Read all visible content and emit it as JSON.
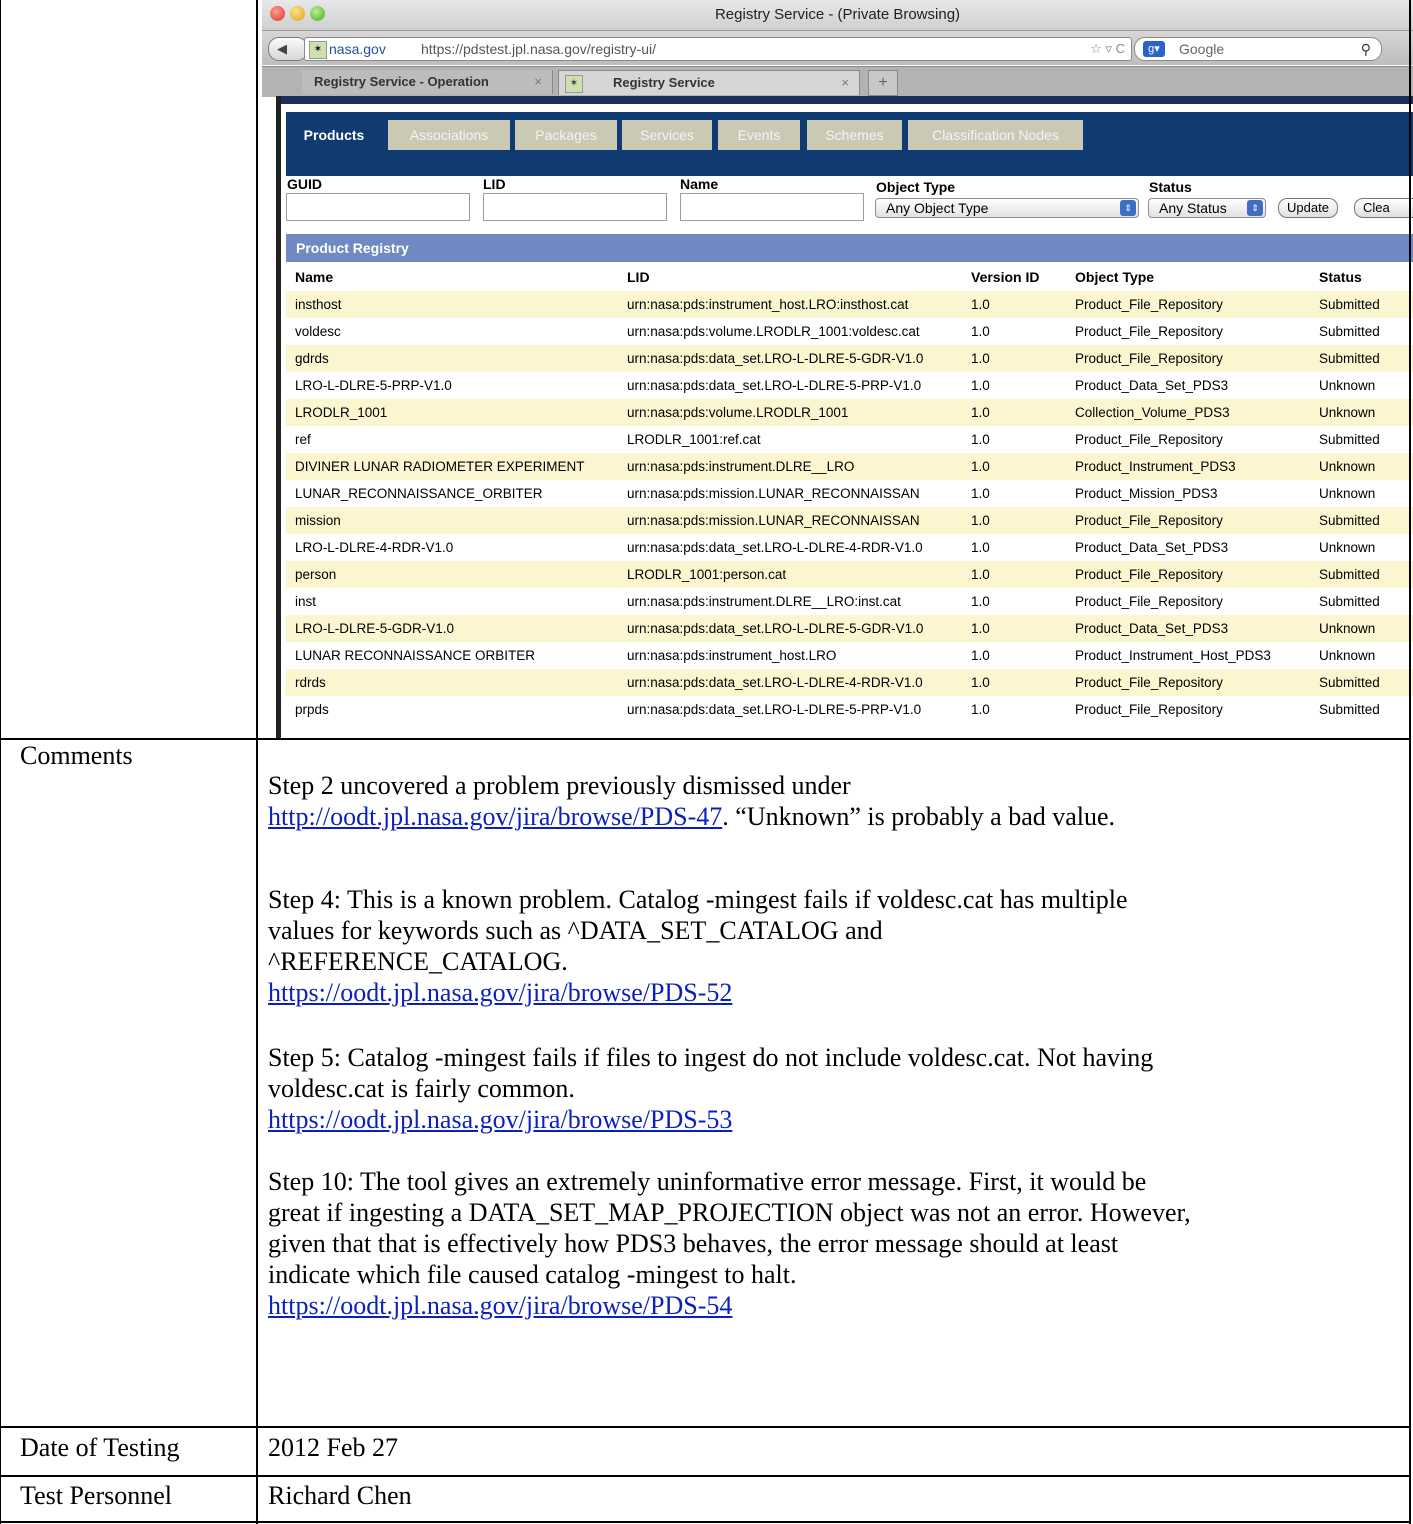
{
  "browser": {
    "window_title": "Registry Service - (Private Browsing)",
    "url_domain": "nasa.gov",
    "url": "https://pdstest.jpl.nasa.gov/registry-ui/",
    "search_engine": "Google",
    "tabs": [
      {
        "label": "Registry Service - Operation"
      },
      {
        "label": "Registry Service"
      }
    ],
    "new_tab": "+"
  },
  "app": {
    "nav_tabs": [
      {
        "label": "Products",
        "active": true
      },
      {
        "label": "Associations"
      },
      {
        "label": "Packages"
      },
      {
        "label": "Services"
      },
      {
        "label": "Events"
      },
      {
        "label": "Schemes"
      },
      {
        "label": "Classification Nodes"
      }
    ],
    "filters": {
      "guid_label": "GUID",
      "lid_label": "LID",
      "name_label": "Name",
      "object_type_label": "Object Type",
      "object_type_value": "Any Object Type",
      "status_label": "Status",
      "status_value": "Any Status",
      "update_button": "Update",
      "clear_button": "Clea"
    },
    "registry_title": "Product Registry",
    "columns": [
      "Name",
      "LID",
      "Version ID",
      "Object Type",
      "Status"
    ],
    "rows": [
      [
        "insthost",
        "urn:nasa:pds:instrument_host.LRO:insthost.cat",
        "1.0",
        "Product_File_Repository",
        "Submitted"
      ],
      [
        "voldesc",
        "urn:nasa:pds:volume.LRODLR_1001:voldesc.cat",
        "1.0",
        "Product_File_Repository",
        "Submitted"
      ],
      [
        "gdrds",
        "urn:nasa:pds:data_set.LRO-L-DLRE-5-GDR-V1.0",
        "1.0",
        "Product_File_Repository",
        "Submitted"
      ],
      [
        "LRO-L-DLRE-5-PRP-V1.0",
        "urn:nasa:pds:data_set.LRO-L-DLRE-5-PRP-V1.0",
        "1.0",
        "Product_Data_Set_PDS3",
        "Unknown"
      ],
      [
        "LRODLR_1001",
        "urn:nasa:pds:volume.LRODLR_1001",
        "1.0",
        "Collection_Volume_PDS3",
        "Unknown"
      ],
      [
        "ref",
        "LRODLR_1001:ref.cat",
        "1.0",
        "Product_File_Repository",
        "Submitted"
      ],
      [
        "DIVINER LUNAR RADIOMETER EXPERIMENT",
        "urn:nasa:pds:instrument.DLRE__LRO",
        "1.0",
        "Product_Instrument_PDS3",
        "Unknown"
      ],
      [
        "LUNAR_RECONNAISSANCE_ORBITER",
        "urn:nasa:pds:mission.LUNAR_RECONNAISSAN",
        "1.0",
        "Product_Mission_PDS3",
        "Unknown"
      ],
      [
        "mission",
        "urn:nasa:pds:mission.LUNAR_RECONNAISSAN",
        "1.0",
        "Product_File_Repository",
        "Submitted"
      ],
      [
        "LRO-L-DLRE-4-RDR-V1.0",
        "urn:nasa:pds:data_set.LRO-L-DLRE-4-RDR-V1.0",
        "1.0",
        "Product_Data_Set_PDS3",
        "Unknown"
      ],
      [
        "person",
        "LRODLR_1001:person.cat",
        "1.0",
        "Product_File_Repository",
        "Submitted"
      ],
      [
        "inst",
        "urn:nasa:pds:instrument.DLRE__LRO:inst.cat",
        "1.0",
        "Product_File_Repository",
        "Submitted"
      ],
      [
        "LRO-L-DLRE-5-GDR-V1.0",
        "urn:nasa:pds:data_set.LRO-L-DLRE-5-GDR-V1.0",
        "1.0",
        "Product_Data_Set_PDS3",
        "Unknown"
      ],
      [
        "LUNAR RECONNAISSANCE ORBITER",
        "urn:nasa:pds:instrument_host.LRO",
        "1.0",
        "Product_Instrument_Host_PDS3",
        "Unknown"
      ],
      [
        "rdrds",
        "urn:nasa:pds:data_set.LRO-L-DLRE-4-RDR-V1.0",
        "1.0",
        "Product_File_Repository",
        "Submitted"
      ],
      [
        "prpds",
        "urn:nasa:pds:data_set.LRO-L-DLRE-5-PRP-V1.0",
        "1.0",
        "Product_File_Repository",
        "Submitted"
      ]
    ]
  },
  "document": {
    "comments_label": "Comments",
    "comments": {
      "p1_text": "Step 2 uncovered a problem previously dismissed under",
      "p1_link": "http://oodt.jpl.nasa.gov/jira/browse/PDS-47",
      "p1_tail": ". “Unknown” is probably a bad value.",
      "p2_line1": "Step 4: This is a known problem. Catalog -mingest fails if voldesc.cat has multiple",
      "p2_line2": "values for keywords such as ^DATA_SET_CATALOG and",
      "p2_line3": "^REFERENCE_CATALOG.",
      "p2_link": "https://oodt.jpl.nasa.gov/jira/browse/PDS-52",
      "p3_line1": "Step 5: Catalog -mingest fails if files to ingest do not include voldesc.cat. Not having",
      "p3_line2": "voldesc.cat is fairly common.",
      "p3_link": "https://oodt.jpl.nasa.gov/jira/browse/PDS-53",
      "p4_line1": "Step 10: The tool gives an extremely uninformative error message. First, it would be",
      "p4_line2": "great if ingesting a DATA_SET_MAP_PROJECTION object was not an error. However,",
      "p4_line3": "given that that is effectively how PDS3 behaves, the error message should at least",
      "p4_line4": "indicate which file caused catalog -mingest to halt.",
      "p4_link": "https://oodt.jpl.nasa.gov/jira/browse/PDS-54"
    },
    "date_label": "Date of Testing",
    "date_value": "2012 Feb 27",
    "personnel_label": "Test Personnel",
    "personnel_value": "Richard Chen"
  }
}
